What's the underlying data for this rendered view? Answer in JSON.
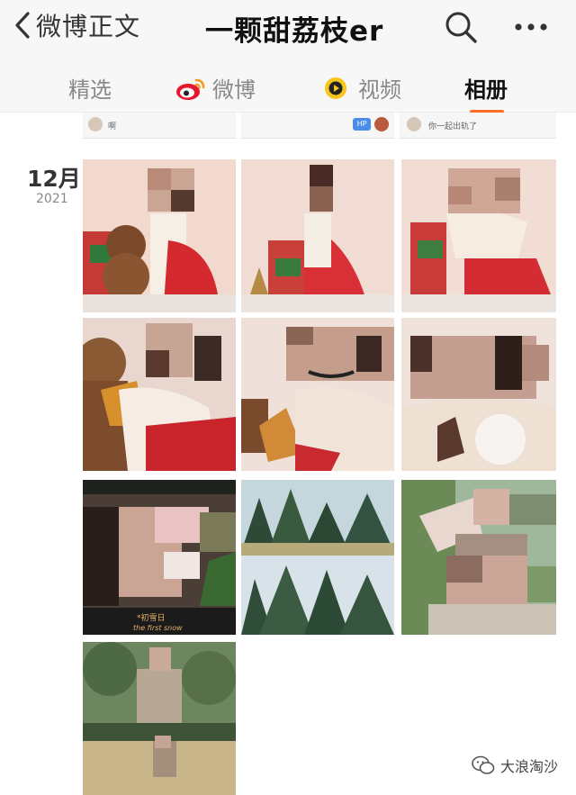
{
  "header": {
    "back_label": "微博正文",
    "title": "一颗甜荔枝er",
    "icons": [
      "chevron-left-icon",
      "search-icon",
      "more-icon"
    ]
  },
  "tabs": [
    {
      "label": "精选",
      "active": false
    },
    {
      "label": "微博",
      "active": false,
      "icon": "weibo-icon"
    },
    {
      "label": "视频",
      "active": false,
      "icon": "video-icon"
    },
    {
      "label": "相册",
      "active": true
    }
  ],
  "strip": {
    "texts": [
      "啊",
      "你一起出轨了"
    ],
    "badge": "HP"
  },
  "date": {
    "month": "12月",
    "year": "2021"
  },
  "photo_captions": {
    "line1": "*初雪日",
    "line2": "the first snow"
  },
  "watermark": {
    "text": "大浪淘沙",
    "icon": "wechat-icon"
  },
  "colors": {
    "accent": "#ff6d2b",
    "topbar": "#f7f7f7",
    "text_dark": "#111111",
    "text_muted": "#888888"
  }
}
